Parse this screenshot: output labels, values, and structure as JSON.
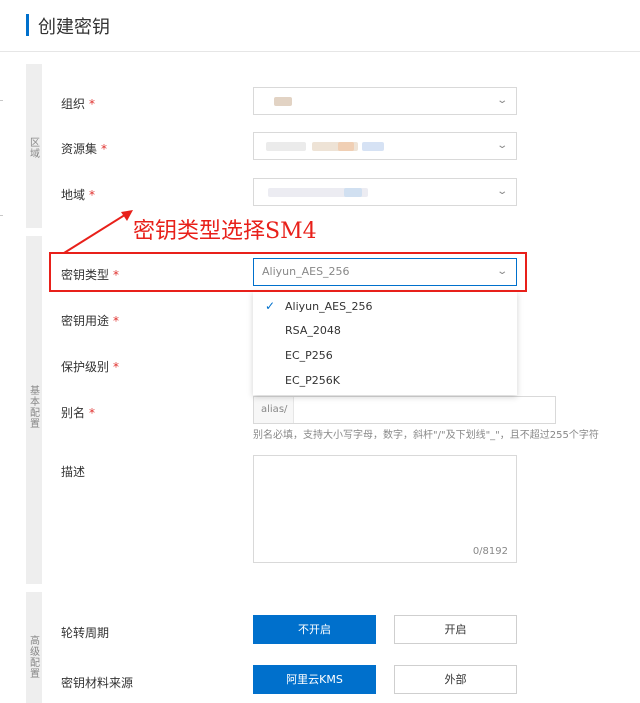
{
  "page": {
    "title": "创建密钥"
  },
  "sections": {
    "region_label": "区域",
    "basic_label": "基本配置",
    "advanced_label": "高级配置"
  },
  "region": {
    "org_label": "组织",
    "resource_set_label": "资源集",
    "region_label": "地域"
  },
  "basic": {
    "key_type_label": "密钥类型",
    "key_type_value": "Aliyun_AES_256",
    "key_usage_label": "密钥用途",
    "protection_label": "保护级别",
    "alias_label": "别名",
    "alias_prefix": "alias/",
    "alias_hint": "别名必填，支持大小写字母，数字，斜杆\"/\"及下划线\"_\"，且不超过255个字符",
    "description_label": "描述",
    "description_counter": "0/8192"
  },
  "dropdown": {
    "options": [
      "Aliyun_AES_256",
      "RSA_2048",
      "EC_P256",
      "EC_P256K"
    ],
    "selected_index": 0
  },
  "annotation": {
    "text": "密钥类型选择SM4",
    "color": "#e8201a"
  },
  "advanced": {
    "rotation_label": "轮转周期",
    "rotation_off": "不开启",
    "rotation_on": "开启",
    "material_label": "密钥材料来源",
    "material_kms": "阿里云KMS",
    "material_external": "外部"
  },
  "colors": {
    "primary": "#0070cc",
    "required": "#e0322f",
    "annotation": "#e8201a"
  }
}
